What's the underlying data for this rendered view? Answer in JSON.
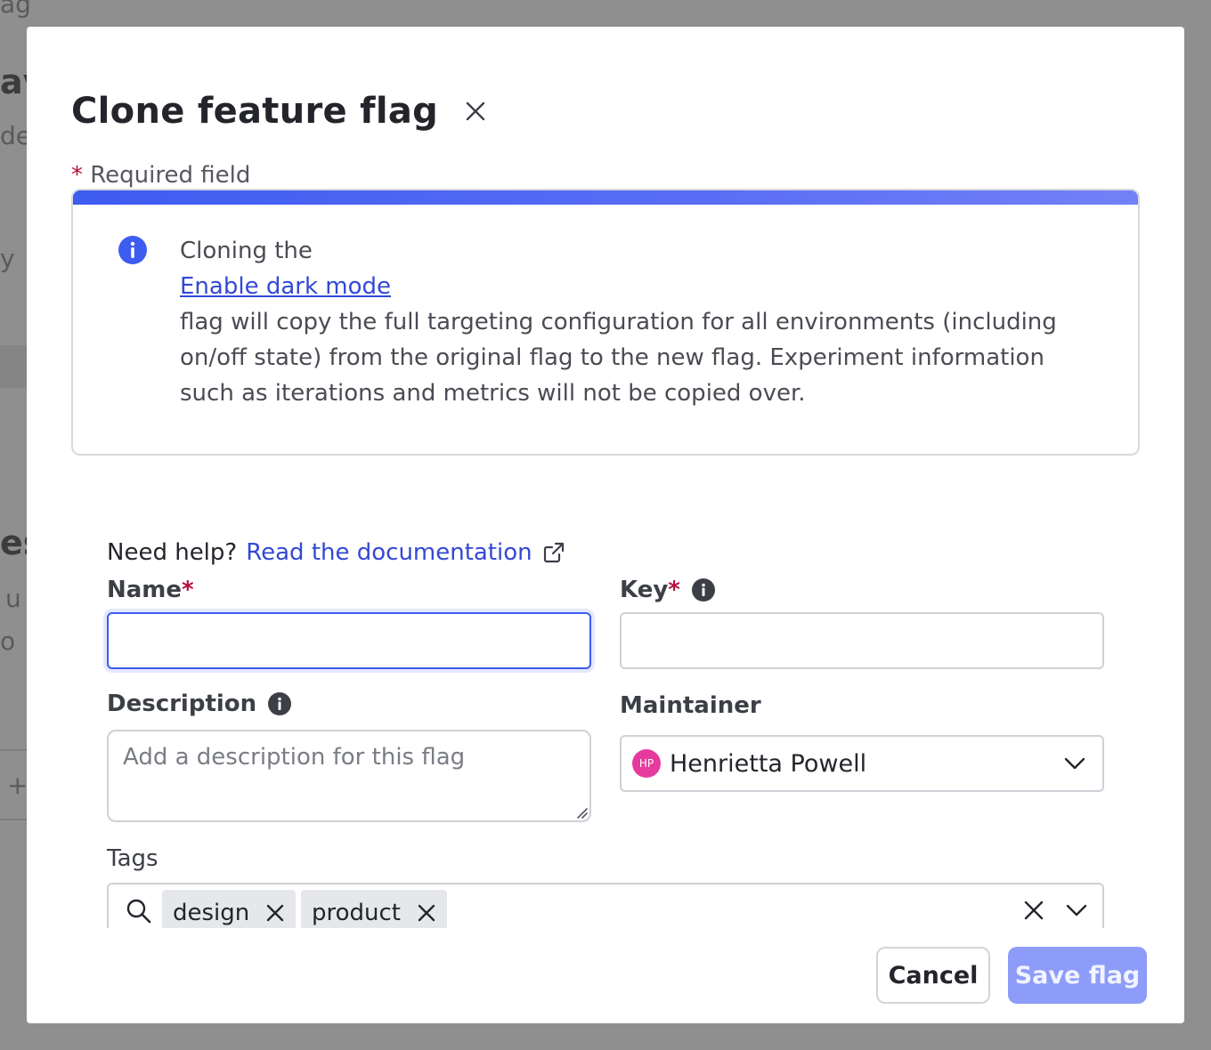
{
  "modal": {
    "title": "Clone feature flag",
    "required_star": "*",
    "required_text": "Required field"
  },
  "callout": {
    "prefix": "Cloning the",
    "flag_name": "Enable dark mode",
    "body": "flag will copy the full targeting configuration for all environments (including on/off state) from the original flag to the new flag. Experiment information such as iterations and metrics will not be copied over."
  },
  "help": {
    "prefix": "Need help?",
    "link_text": "Read the documentation"
  },
  "form": {
    "name_label": "Name",
    "name_value": "",
    "key_label": "Key",
    "key_value": "",
    "required_star": "*",
    "description_label": "Description",
    "description_placeholder": "Add a description for this flag",
    "maintainer_label": "Maintainer",
    "maintainer_initials": "HP",
    "maintainer_name": "Henrietta Powell",
    "tags_label": "Tags",
    "tags": [
      "design",
      "product"
    ]
  },
  "actions": {
    "cancel_label": "Cancel",
    "save_label": "Save flag"
  },
  "colors": {
    "accent": "#3d5cf0",
    "link": "#3348d6",
    "required": "#b5113d",
    "save_disabled": "#8e9cf9",
    "avatar": "#e73a9e"
  }
}
